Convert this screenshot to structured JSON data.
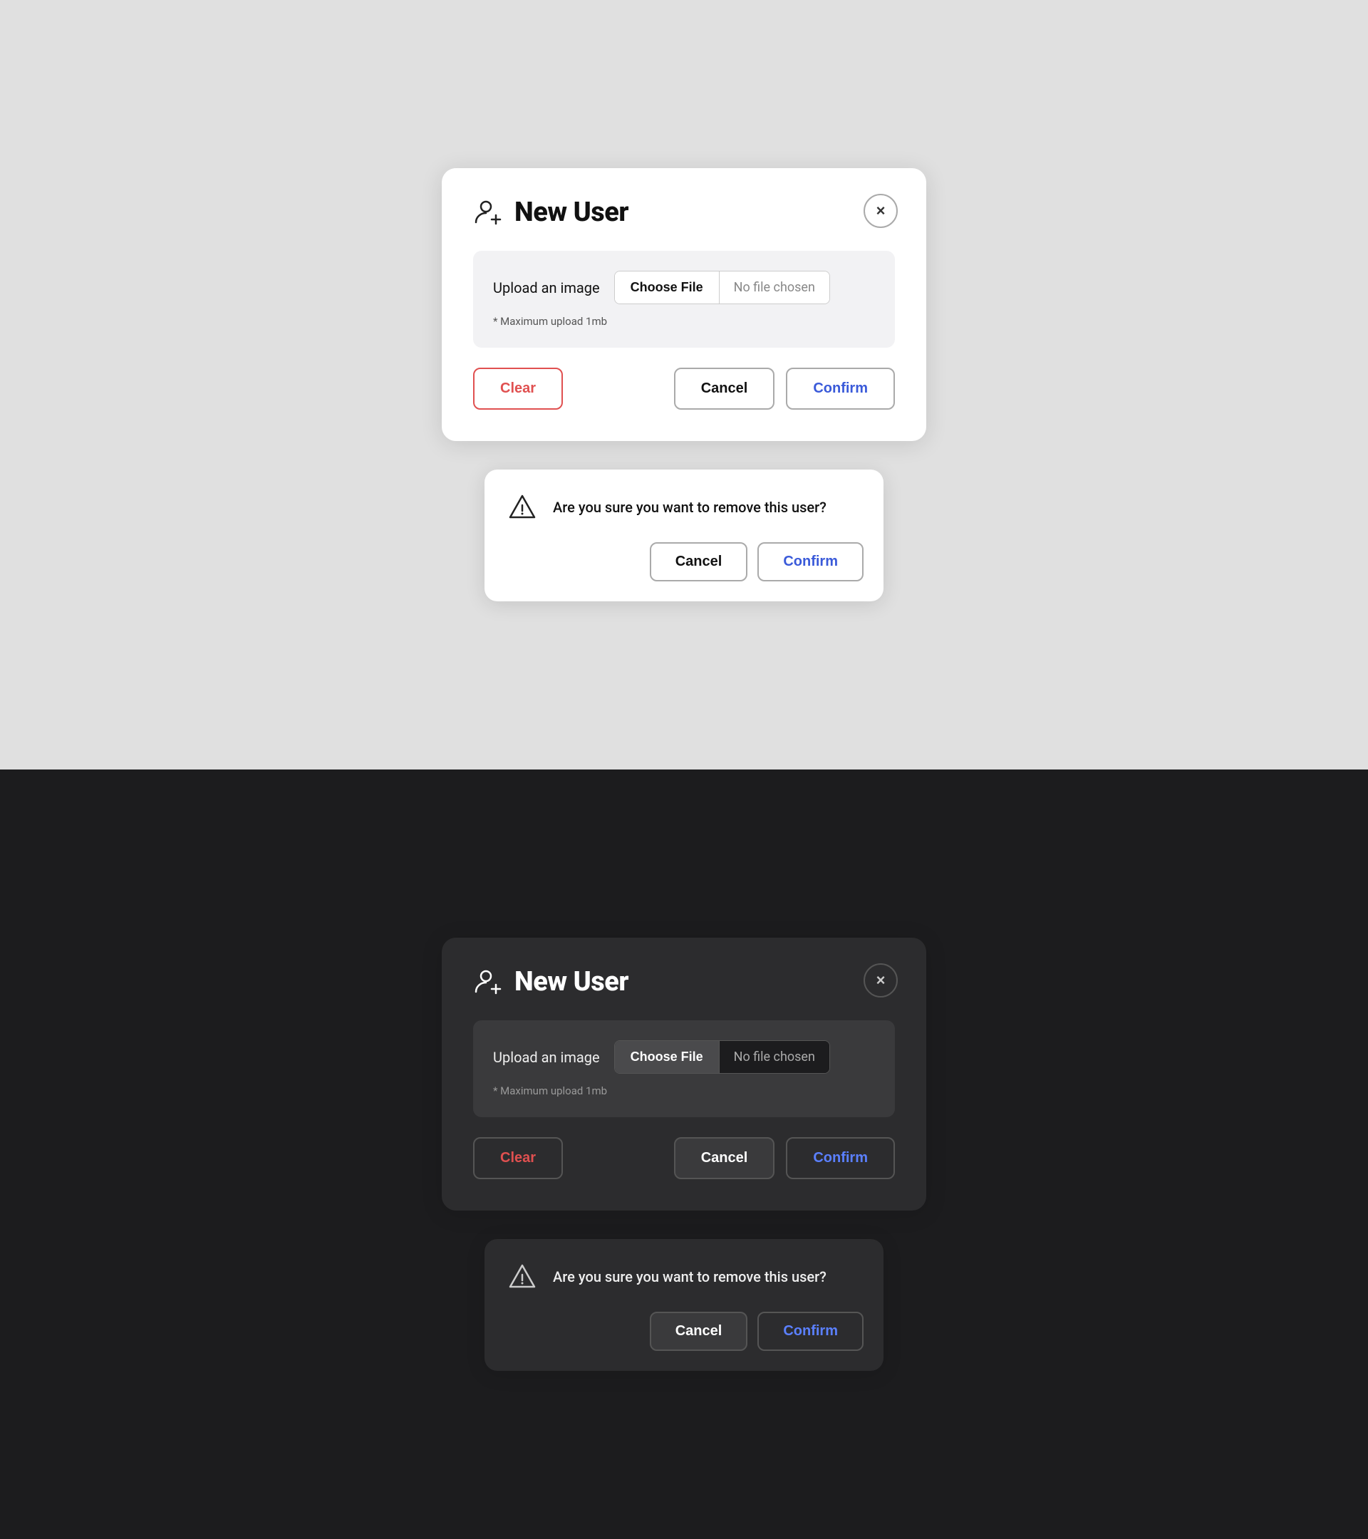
{
  "light": {
    "theme": "light",
    "modal": {
      "title": "New User",
      "close_label": "×",
      "upload_label": "Upload an image",
      "choose_file_label": "Choose File",
      "no_file_label": "No file chosen",
      "upload_note": "* Maximum upload 1mb",
      "clear_label": "Clear",
      "cancel_label": "Cancel",
      "confirm_label": "Confirm"
    },
    "dialog": {
      "message": "Are you sure you want to remove this user?",
      "cancel_label": "Cancel",
      "confirm_label": "Confirm"
    }
  },
  "dark": {
    "theme": "dark",
    "modal": {
      "title": "New User",
      "close_label": "×",
      "upload_label": "Upload an image",
      "choose_file_label": "Choose File",
      "no_file_label": "No file chosen",
      "upload_note": "* Maximum upload 1mb",
      "clear_label": "Clear",
      "cancel_label": "Cancel",
      "confirm_label": "Confirm"
    },
    "dialog": {
      "message": "Are you sure you want to remove this user?",
      "cancel_label": "Cancel",
      "confirm_label": "Confirm"
    }
  }
}
